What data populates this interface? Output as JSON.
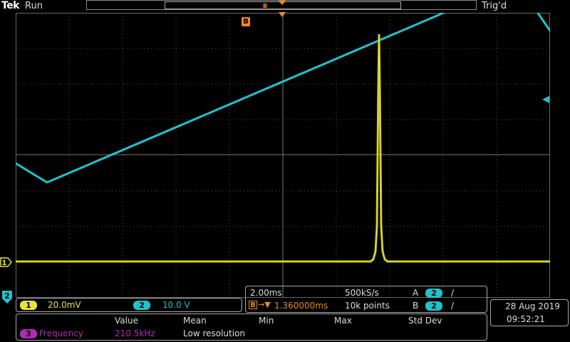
{
  "header": {
    "brand": "Tek",
    "run_state": "Run",
    "trigger_status": "Trig'd",
    "record_marker": "B"
  },
  "screen": {
    "b_marker_label": "B",
    "ch1_marker_label": "1",
    "ch2_marker_label": "2",
    "ch1_color": "#e8e33c",
    "ch2_color": "#1fc3cc",
    "math_color": "#b12ab5",
    "trigger_color": "#f08a1c"
  },
  "channels": {
    "ch1_label": "1",
    "ch1_scale": "20.0mV",
    "ch2_label": "2",
    "ch2_scale": "10.0 V"
  },
  "timebase": {
    "horizontal_scale": "2.00ms",
    "sample_rate": "500kS/s",
    "delay_marker": "B",
    "delay_value": "1.360000ms",
    "record_length": "10k points",
    "trigger_a_label": "A",
    "trigger_a_source": "2",
    "trigger_a_slope": "/",
    "trigger_b_label": "B",
    "trigger_b_source": "2",
    "trigger_b_slope": "/"
  },
  "clock": {
    "date": "28 Aug 2019",
    "time": "09:52:21"
  },
  "measurements": {
    "columns": [
      "Value",
      "Mean",
      "Min",
      "Max",
      "Std Dev"
    ],
    "rows": [
      {
        "source": "3",
        "name": "Frequency",
        "value": "210.5kHz",
        "note": "Low resolution"
      }
    ]
  }
}
